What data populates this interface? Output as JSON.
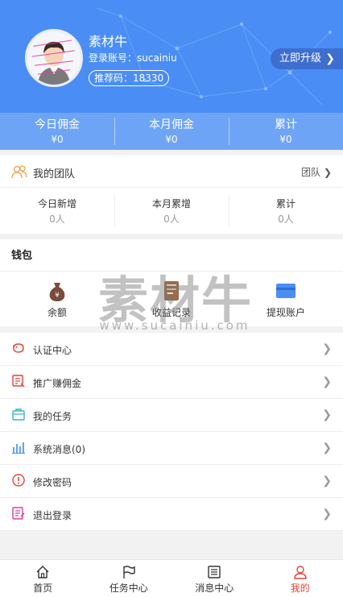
{
  "profile": {
    "nickname": "素材牛",
    "account": "登录账号：sucainiu",
    "referral": "推荐码：18330",
    "upgrade_label": "立即升级"
  },
  "earnings": [
    {
      "label": "今日佣金",
      "value": "¥0"
    },
    {
      "label": "本月佣金",
      "value": "¥0"
    },
    {
      "label": "累计",
      "value": "¥0"
    }
  ],
  "team": {
    "title": "我的团队",
    "link": "团队",
    "cells": [
      {
        "label": "今日新增",
        "value": "0人"
      },
      {
        "label": "本月累增",
        "value": "0人"
      },
      {
        "label": "累计",
        "value": "0人"
      }
    ]
  },
  "wallet": {
    "title": "钱包",
    "items": [
      {
        "label": "余额",
        "icon": "money-bag-icon"
      },
      {
        "label": "收益记录",
        "icon": "income-record-icon"
      },
      {
        "label": "提现账户",
        "icon": "bank-card-icon"
      }
    ]
  },
  "watermark": {
    "text": "素材牛",
    "url": "www.sucainiu.com"
  },
  "menu": [
    {
      "label": "认证中心",
      "icon": "piggy-bank-icon"
    },
    {
      "label": "推广赚佣金",
      "icon": "promotion-icon"
    },
    {
      "label": "我的任务",
      "icon": "task-bag-icon"
    },
    {
      "label": "系统消息(0)",
      "icon": "bar-chart-icon"
    },
    {
      "label": "修改密码",
      "icon": "alert-circle-icon"
    },
    {
      "label": "退出登录",
      "icon": "logout-note-icon"
    }
  ],
  "tabs": [
    {
      "label": "首页",
      "icon": "home-icon"
    },
    {
      "label": "任务中心",
      "icon": "flag-icon"
    },
    {
      "label": "消息中心",
      "icon": "list-icon"
    },
    {
      "label": "我的",
      "icon": "user-icon",
      "active": true
    }
  ],
  "colors": {
    "header": "#4a8ef5",
    "active_tab": "#e0443a"
  }
}
